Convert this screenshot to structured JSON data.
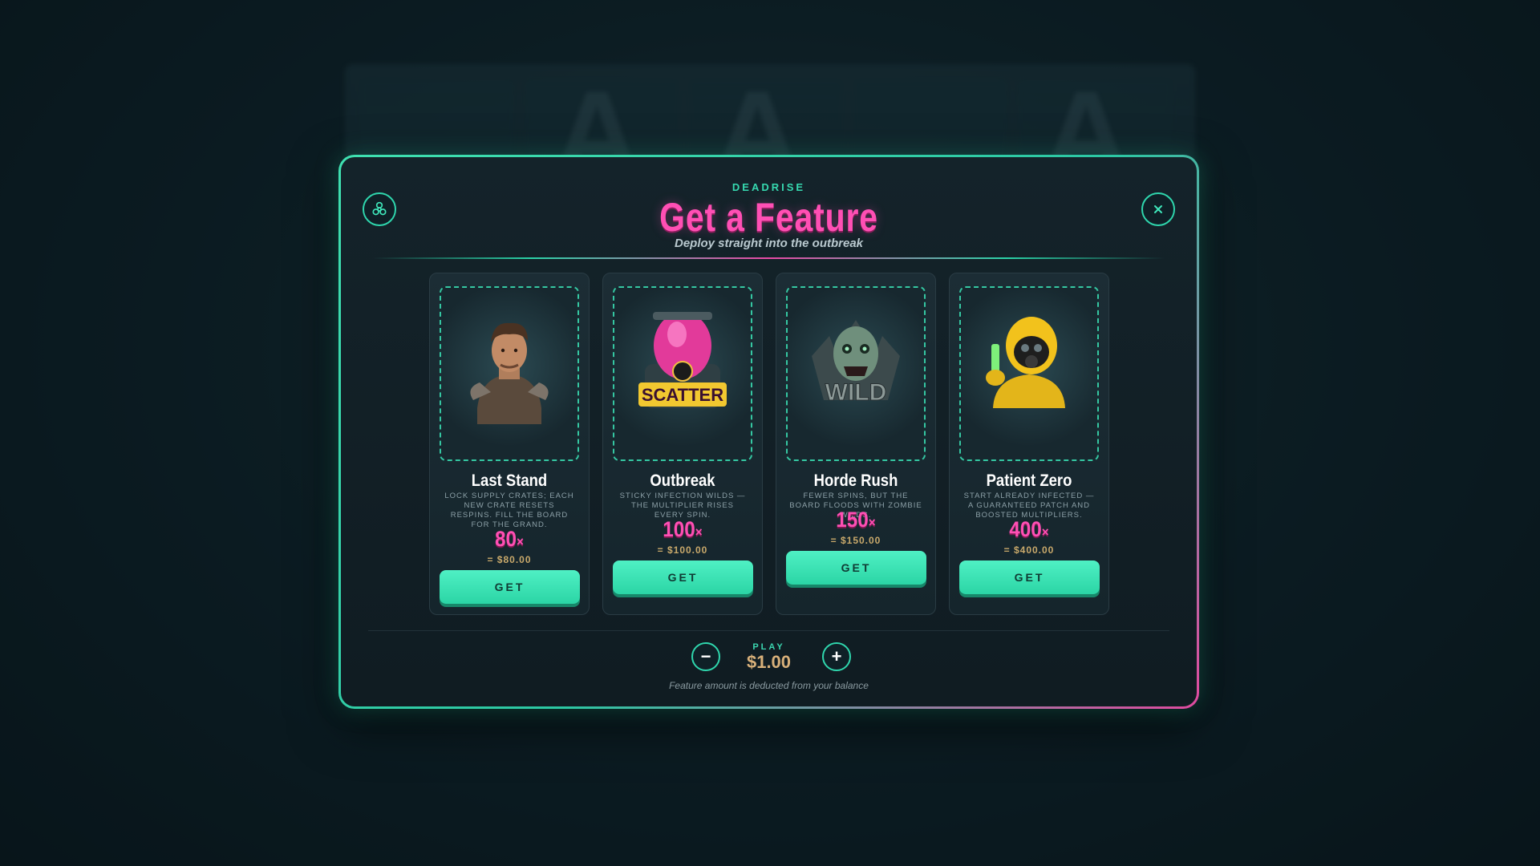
{
  "header": {
    "brand": "DEADRISE",
    "title": "Get a Feature",
    "subtitle": "Deploy straight into the outbreak"
  },
  "icons": {
    "top_left": "biohazard-icon",
    "top_right": "close-icon"
  },
  "features": [
    {
      "name": "Last Stand",
      "description": "Lock supply crates; each new crate resets respins. Fill the board for the grand.",
      "multiplier": "80",
      "multiplier_suffix": "×",
      "price": "= $80.00",
      "button": "GET",
      "art": "soldier-survivor-icon"
    },
    {
      "name": "Outbreak",
      "description": "Sticky infection wilds — the multiplier rises every spin.",
      "multiplier": "100",
      "multiplier_suffix": "×",
      "price": "= $100.00",
      "button": "GET",
      "art": "scatter-biohazard-icon"
    },
    {
      "name": "Horde Rush",
      "description": "Fewer spins, but the board floods with zombie wilds.",
      "multiplier": "150",
      "multiplier_suffix": "×",
      "price": "= $150.00",
      "button": "GET",
      "art": "zombie-wild-icon"
    },
    {
      "name": "Patient Zero",
      "description": "Start already infected — a guaranteed patch and boosted multipliers.",
      "multiplier": "400",
      "multiplier_suffix": "×",
      "price": "= $400.00",
      "button": "GET",
      "art": "hazmat-figure-icon"
    }
  ],
  "bet": {
    "label": "PLAY",
    "value": "$1.00",
    "decrease": "−",
    "increase": "+"
  },
  "footnote": "Feature amount is deducted from your balance",
  "colors": {
    "accent_teal": "#2fd6ad",
    "accent_pink": "#ff4fb4",
    "price_gold": "#c9a96b"
  }
}
